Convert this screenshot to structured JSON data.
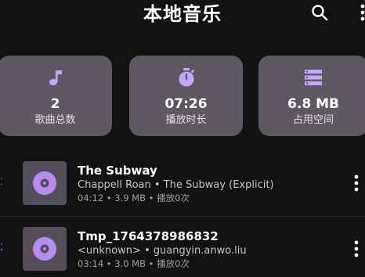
{
  "header": {
    "title": "本地音乐",
    "search_icon": "search-icon",
    "more_icon": "more-vert-icon"
  },
  "stats": [
    {
      "icon": "music-note-icon",
      "value": "2",
      "label": "歌曲总数"
    },
    {
      "icon": "timer-icon",
      "value": "07:26",
      "label": "播放时长"
    },
    {
      "icon": "storage-icon",
      "value": "6.8 MB",
      "label": "占用空间"
    }
  ],
  "tracks": [
    {
      "index": "1",
      "title": "The Subway",
      "subtitle": "Chappell Roan • The Subway (Explicit)",
      "meta": "04:12 • 3.9 MB • 播放0次"
    },
    {
      "index": "2",
      "title": "Tmp_1764378986832",
      "subtitle": "<unknown> • guangyin.anwo.liu",
      "meta": "03:14 • 3.0 MB • 播放0次"
    }
  ],
  "colors": {
    "background": "#121212",
    "card": "#5d5862",
    "accent": "#c4a6ff",
    "disc": "#b88cf0"
  }
}
